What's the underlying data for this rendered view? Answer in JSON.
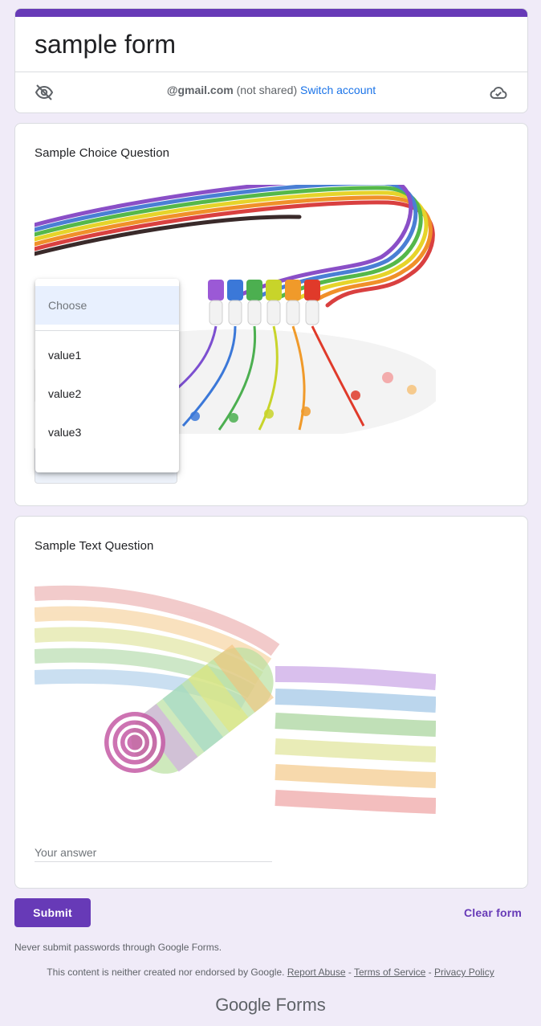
{
  "header": {
    "title": "sample form",
    "account_email": "@gmail.com",
    "account_note": " (not shared) ",
    "switch_account": "Switch account"
  },
  "questions": [
    {
      "title": "Sample Choice Question",
      "dropdown": {
        "placeholder": "Choose",
        "options": [
          "value1",
          "value2",
          "value3"
        ]
      }
    },
    {
      "title": "Sample Text Question",
      "answer_placeholder": "Your answer"
    }
  ],
  "footer": {
    "submit_label": "Submit",
    "clear_label": "Clear form",
    "warning": "Never submit passwords through Google Forms.",
    "disclaimer": "This content is neither created nor endorsed by Google.",
    "report_abuse": "Report Abuse",
    "separator": " - ",
    "terms": "Terms of Service",
    "privacy": "Privacy Policy",
    "brand_google": "Google",
    "brand_forms": "Forms"
  },
  "colors": {
    "accent": "#673ab7",
    "background": "#f0ebf8",
    "link": "#1a73e8"
  },
  "icons": {
    "hidden": "eye-off-icon",
    "cloud": "cloud-check-icon"
  }
}
